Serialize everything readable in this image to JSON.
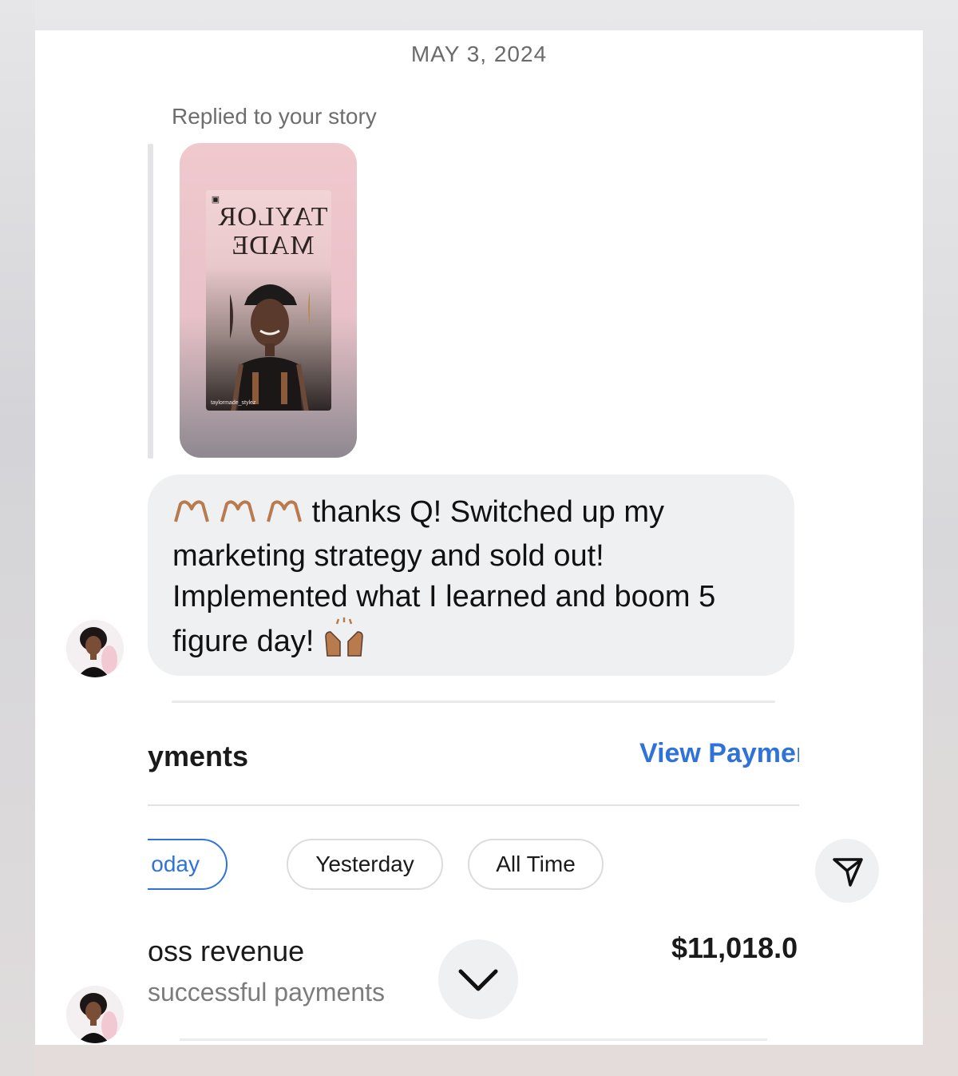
{
  "conversation": {
    "date": "MAY 3, 2024",
    "story_reply_label": "Replied to your story",
    "story": {
      "sign_line1": "TAYLOR",
      "sign_line2": "MADE",
      "watermark": "taylormade_stylez"
    },
    "message": {
      "emoji_prefix": "heart-hands x3",
      "text_line1": "thanks Q! Switched up my",
      "text_line2": "marketing strategy and sold out!",
      "text_line3": "Implemented what I learned and boom 5",
      "text_line4": "figure day!",
      "emoji_suffix": "raising-hands"
    }
  },
  "shared_screenshot": {
    "section_title": "yments",
    "view_link": "View Paymen",
    "filters": [
      {
        "label": "Today",
        "visible_label": "oday",
        "selected": true
      },
      {
        "label": "Yesterday",
        "selected": false
      },
      {
        "label": "All Time",
        "selected": false
      }
    ],
    "revenue_label": "oss revenue",
    "revenue_value": "$11,018.0",
    "payments_label": "successful payments"
  },
  "icons": {
    "send": "send-icon",
    "scroll_down": "chevron-down-icon"
  },
  "colors": {
    "accent": "#2f73d9",
    "bubble": "#eff0f2",
    "text": "#111111",
    "muted": "#6e6e6e"
  }
}
